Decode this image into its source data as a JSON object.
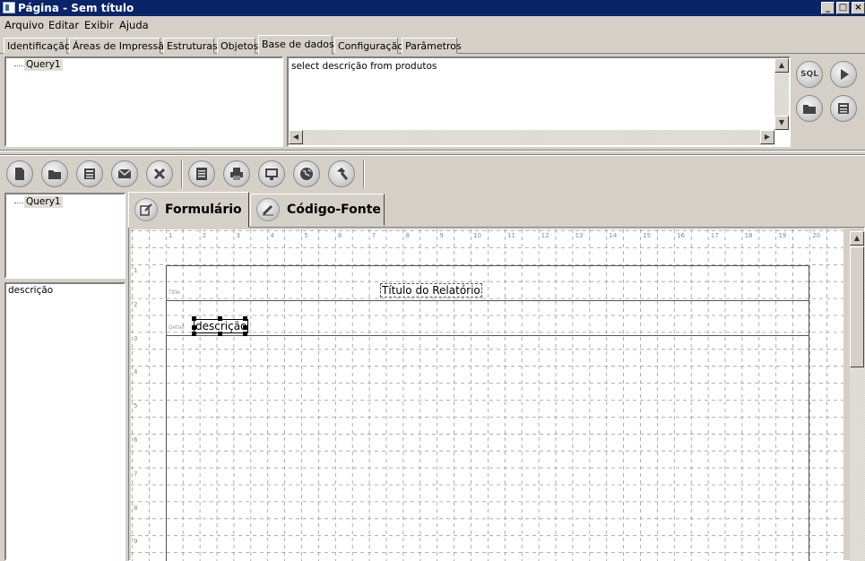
{
  "window": {
    "title": "Página - Sem título",
    "controls": [
      "_",
      "□",
      "×"
    ]
  },
  "menu": [
    "Arquivo",
    "Editar",
    "Exibir",
    "Ajuda"
  ],
  "top_tabs": [
    "Identificação",
    "Áreas de Impressão",
    "Estruturas",
    "Objetos",
    "Base de dados",
    "Configuração",
    "Parâmetros"
  ],
  "active_top_tab": "Base de dados",
  "query_tree": {
    "item": "Query1"
  },
  "sql": {
    "text": "select  descrição from produtos"
  },
  "sql_buttons": {
    "sql_label": "SQL",
    "icons": [
      "sql-icon",
      "play-icon",
      "folder-icon",
      "save-icon"
    ]
  },
  "toolbar": {
    "icons": [
      "new-document-icon",
      "open-folder-icon",
      "save-icon",
      "email-icon",
      "close-icon",
      "print-preview-icon",
      "printer-icon",
      "monitor-icon",
      "globe-icon",
      "hammer-icon"
    ]
  },
  "left_tree": {
    "item": "Query1"
  },
  "fields_list": [
    "descrição"
  ],
  "editor_tabs": [
    "Formulário",
    "Código-Fonte"
  ],
  "active_editor_tab": "Formulário",
  "ruler": {
    "h": [
      "1",
      "2",
      "3",
      "4",
      "5",
      "6",
      "7",
      "8",
      "9",
      "10",
      "11",
      "12",
      "13",
      "14",
      "15",
      "16",
      "17",
      "18",
      "19",
      "20"
    ],
    "v": [
      "1",
      "2",
      "3",
      "4",
      "5",
      "6",
      "7",
      "8",
      "9"
    ]
  },
  "report": {
    "bands": [
      {
        "label": "Title"
      },
      {
        "label": "Detail"
      }
    ],
    "title_text": "Título do Relatório",
    "detail_field": "descrição"
  }
}
